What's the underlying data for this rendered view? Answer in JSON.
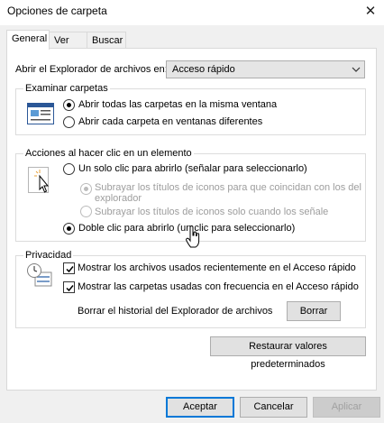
{
  "window": {
    "title": "Opciones de carpeta",
    "close_glyph": "✕"
  },
  "tabs": [
    {
      "label": "General"
    },
    {
      "label": "Ver"
    },
    {
      "label": "Buscar"
    }
  ],
  "explorer_open": {
    "label": "Abrir el Explorador de archivos en:",
    "selected": "Acceso rápido"
  },
  "browse": {
    "legend": "Examinar carpetas",
    "options": [
      {
        "label": "Abrir todas las carpetas en la misma ventana",
        "selected": true
      },
      {
        "label": "Abrir cada carpeta en ventanas diferentes",
        "selected": false
      }
    ]
  },
  "click": {
    "legend": "Acciones al hacer clic en un elemento",
    "single": "Un solo clic para abrirlo (señalar para seleccionarlo)",
    "sub1_line1": "Subrayar los títulos de iconos para que coincidan con los del",
    "sub1_line2": "explorador",
    "sub2": "Subrayar los títulos de iconos solo cuando los señale",
    "double": "Doble clic para abrirlo (un clic para seleccionarlo)"
  },
  "privacy": {
    "legend": "Privacidad",
    "recent_files": "Mostrar los archivos usados recientemente en el Acceso rápido",
    "frequent_folders": "Mostrar las carpetas usadas con frecuencia en el Acceso rápido",
    "clear_label": "Borrar el historial del Explorador de archivos",
    "clear_button": "Borrar"
  },
  "restore_button": "Restaurar valores predeterminados",
  "footer": {
    "ok": "Aceptar",
    "cancel": "Cancelar",
    "apply": "Aplicar"
  },
  "colors": {
    "accent": "#0078d7",
    "panel": "#ffffff",
    "chrome": "#f0f0f0"
  }
}
